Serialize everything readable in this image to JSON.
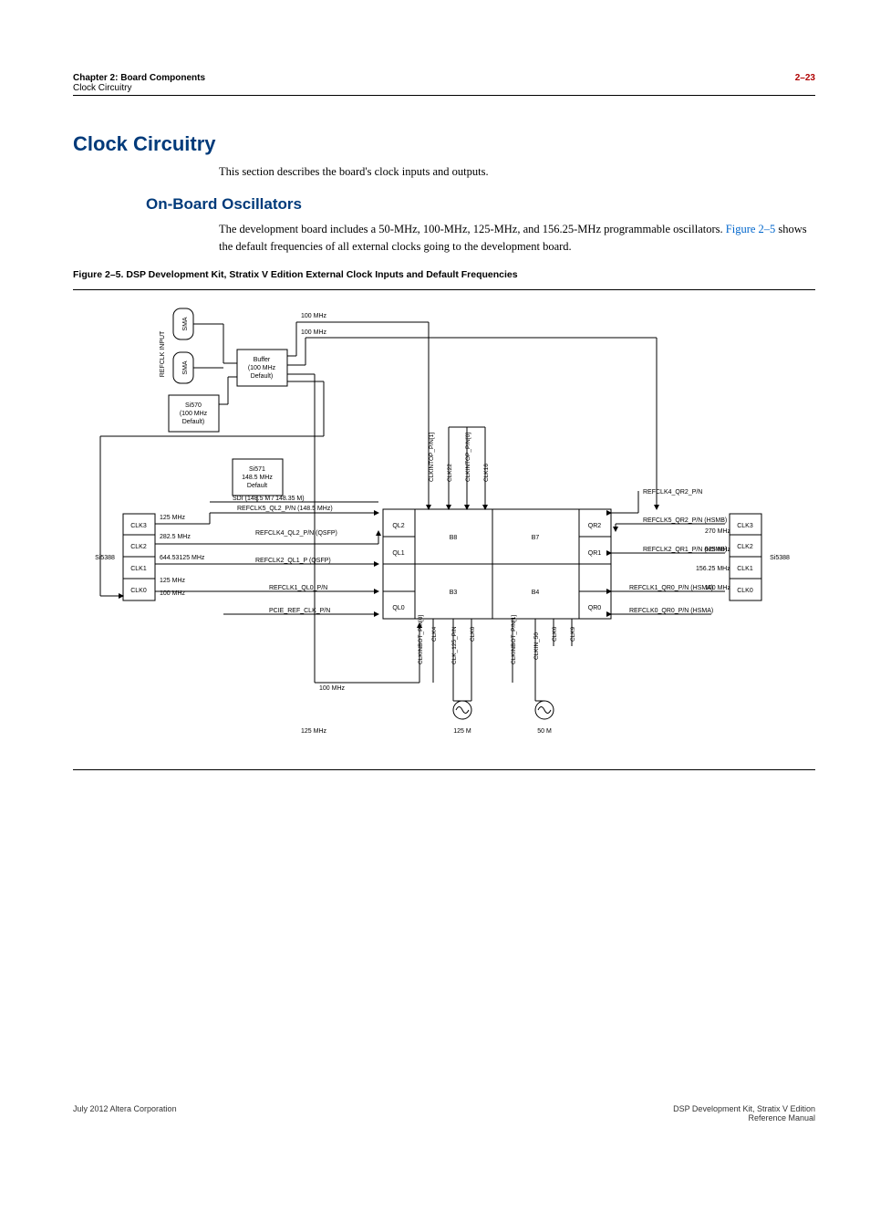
{
  "header": {
    "chapter_line": "Chapter 2: Board Components",
    "sub_line": "Clock Circuitry",
    "page_num": "2–23"
  },
  "section": {
    "title": "Clock Circuitry",
    "intro": "This section describes the board's clock inputs and outputs."
  },
  "subsection": {
    "title": "On-Board Oscillators",
    "body_a": "The development board includes a 50-MHz, 100-MHz, 125-MHz, and 156.25-MHz programmable oscillators. ",
    "fig_link": "Figure 2–5",
    "body_b": " shows the default frequencies of all external clocks going to the development board."
  },
  "figure": {
    "caption": "Figure 2–5.  DSP Development Kit, Stratix V Edition External Clock Inputs and Default Frequencies",
    "labels": {
      "sma1": "SMA",
      "sma2": "SMA",
      "refclk_input": "REFCLK INPUT",
      "buffer": "Buffer (100 MHz Default)",
      "si570": "Si570 (100 MHz Default)",
      "si571": "Si571 148.5 MHz Default",
      "freq_100_1": "100 MHz",
      "freq_100_2": "100 MHz",
      "freq_100_3": "100 MHz",
      "freq_100_4": "100 MHz",
      "freq_100_5": "100 MHz",
      "freq_125_left": "125 MHz",
      "freq_125_left2": "125 MHz",
      "freq_125_bottom": "125 MHz",
      "freq_125m": "125 M",
      "freq_50m": "50 M",
      "freq_282_5": "282.5 MHz",
      "freq_644": "644.53125 MHz",
      "freq_270": "270 MHz",
      "freq_625": "625 MHz",
      "freq_156_25": "156.25 MHz",
      "sdi": "SDI (148.5 M / 148.35 M)",
      "refclk5_ql2": "REFCLK5_QL2_P/N (148.5 MHz)",
      "refclk4_ql2": "REFCLK4_QL2_P/N (QSFP)",
      "refclk2_ql1": "REFCLK2_QL1_P (QSFP)",
      "refclk1_ql0": "REFCLK1_QL0_P/N",
      "pcie_ref": "PCIE_REF_CLK_P/N",
      "refclk4_qr2": "REFCLK4_QR2_P/N",
      "refclk5_qr2": "REFCLK5_QR2_P/N (HSMB)",
      "refclk2_qr1": "REFCLK2_QR1_P/N (HSMB)",
      "refclk1_qr0": "REFCLK1_QR0_P/N (HSMA)",
      "refclk0_qr0": "REFCLK0_QR0_P/N (HSMA)",
      "si5388_l": "Si5388",
      "si5388_r": "Si5388",
      "clk0_l": "CLK0",
      "clk1_l": "CLK1",
      "clk2_l": "CLK2",
      "clk3_l": "CLK3",
      "clk0_r": "CLK0",
      "clk1_r": "CLK1",
      "clk2_r": "CLK2",
      "clk3_r": "CLK3",
      "ql0": "QL0",
      "ql1": "QL1",
      "ql2": "QL2",
      "qr0": "QR0",
      "qr1": "QR1",
      "qr2": "QR2",
      "b3": "B3",
      "b4": "B4",
      "b7": "B7",
      "b8": "B8",
      "clkintop_pn1": "CLKINTOP_P/N[1]",
      "clkintop_pn0": "CLKINTOP_P/N[0]",
      "clk22": "CLK22",
      "clk16": "CLK16",
      "clkinbot_pn0": "CLKINBOT_P/N[0]",
      "clk4": "CLK4",
      "clk_125_pn": "CLK_125_P/N",
      "clk0_bot": "CLK0",
      "clkinbot_pn1": "CLKINBOT_P/N[1]",
      "clkin_50": "CLKIN_50",
      "clk6": "CLK6",
      "clk9": "CLK9"
    }
  },
  "footer": {
    "left": "July 2012   Altera Corporation",
    "right_a": "DSP Development Kit, Stratix V Edition",
    "right_b": "Reference Manual"
  }
}
